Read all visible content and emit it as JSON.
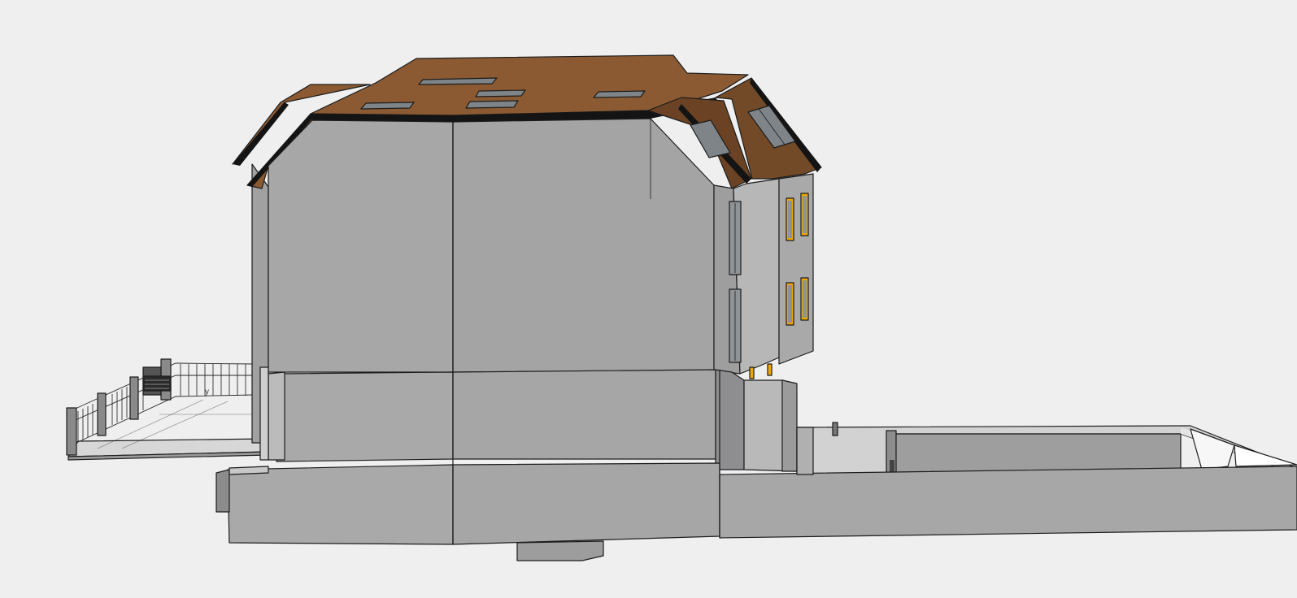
{
  "viewport": {
    "background": "#efefef",
    "axis_label": "y"
  },
  "colors": {
    "wall_main": "#a8a8a9",
    "wall_light": "#b9b9ba",
    "wall_dark": "#8e8e90",
    "roof": "#8b5a32",
    "roof_dark": "#5e3a1e",
    "roof_edge": "#141414",
    "window_glass": "#7e8487",
    "window_lit": "#f0a800",
    "fence": "#dcdcdc"
  }
}
